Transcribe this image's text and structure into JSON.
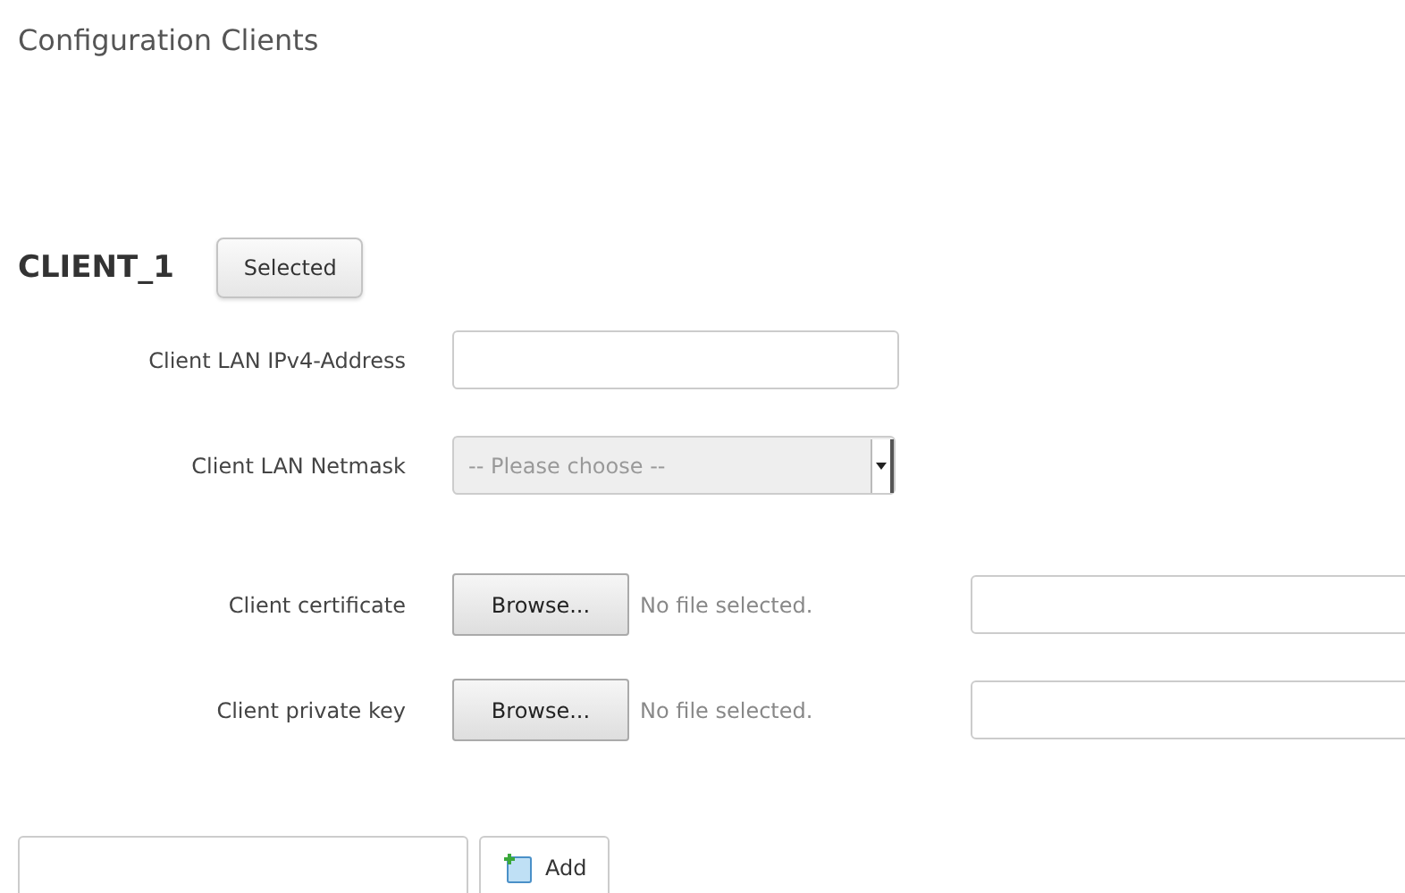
{
  "title": "Configuration Clients",
  "section": {
    "name": "CLIENT_1",
    "button": "Selected"
  },
  "fields": [
    {
      "kind": "text",
      "label": "Client LAN IPv4-Address"
    },
    {
      "kind": "select",
      "label": "Client LAN Netmask",
      "placeholder": "-- Please choose --",
      "disabled": true
    },
    {
      "kind": "file",
      "label": "Client certificate",
      "button": "Browse...",
      "status": "No file selected."
    },
    {
      "kind": "file",
      "label": "Client private key",
      "button": "Browse...",
      "status": "No file selected."
    }
  ],
  "add": {
    "button": "Add"
  }
}
